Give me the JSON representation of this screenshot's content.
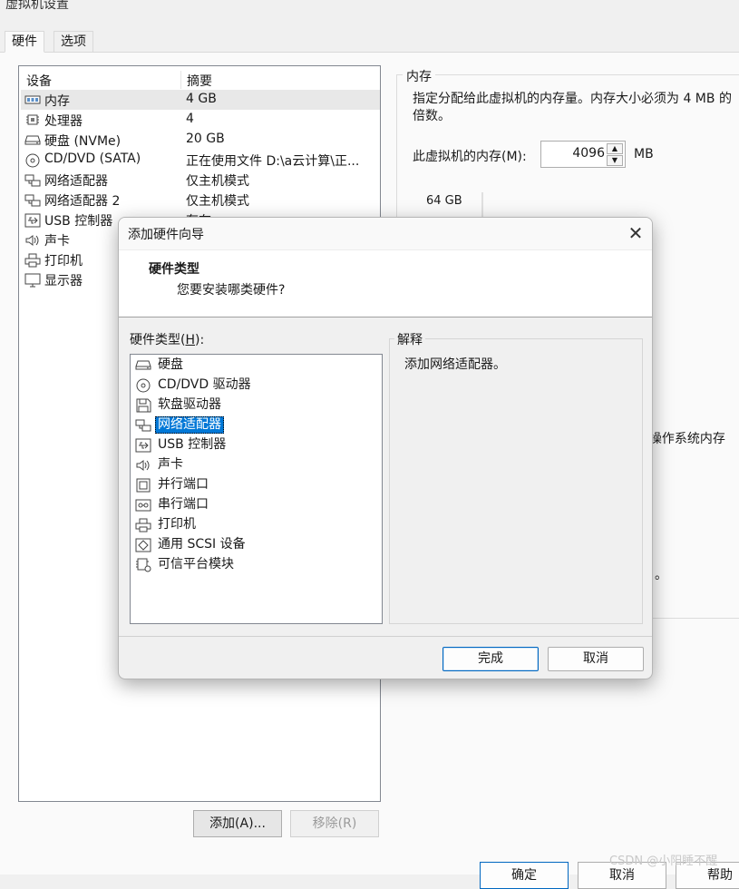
{
  "window": {
    "title": "虚拟机设置"
  },
  "tabs": [
    {
      "label": "硬件"
    },
    {
      "label": "选项"
    }
  ],
  "device_table": {
    "headers": [
      "设备",
      "摘要"
    ],
    "rows": [
      {
        "name": "内存",
        "summary": "4 GB",
        "icon": "memory-icon",
        "selected": true
      },
      {
        "name": "处理器",
        "summary": "4",
        "icon": "cpu-icon"
      },
      {
        "name": "硬盘 (NVMe)",
        "summary": "20 GB",
        "icon": "hard-disk-icon"
      },
      {
        "name": "CD/DVD (SATA)",
        "summary": "正在使用文件 D:\\a云计算\\正...",
        "icon": "cd-dvd-icon"
      },
      {
        "name": "网络适配器",
        "summary": "仅主机模式",
        "icon": "network-adapter-icon"
      },
      {
        "name": "网络适配器 2",
        "summary": "仅主机模式",
        "icon": "network-adapter-icon"
      },
      {
        "name": "USB 控制器",
        "summary": "存在",
        "icon": "usb-icon"
      },
      {
        "name": "声卡",
        "summary": "",
        "icon": "speaker-icon"
      },
      {
        "name": "打印机",
        "summary": "",
        "icon": "printer-icon"
      },
      {
        "name": "显示器",
        "summary": "",
        "icon": "monitor-icon"
      }
    ]
  },
  "device_buttons": {
    "add": "添加(A)...",
    "remove": "移除(R)"
  },
  "memory_panel": {
    "group_title": "内存",
    "description": "指定分配给此虚拟机的内存量。内存大小必须为 4 MB 的倍数。",
    "memory_label": "此虚拟机的内存(M):",
    "memory_value": "4096",
    "unit": "MB",
    "slider_top_label": "64 GB",
    "bg_text_1": "l操作系统内存",
    "bg_text_2": "。"
  },
  "footer_buttons": {
    "ok": "确定",
    "cancel": "取消",
    "help": "帮助"
  },
  "watermark": "CSDN @小阳睡不醒",
  "dialog": {
    "title": "添加硬件向导",
    "close_glyph": "✕",
    "header_title": "硬件类型",
    "header_subtitle": "您要安装哪类硬件?",
    "list_label": "硬件类型(H):",
    "list_label_text": "硬件类型(",
    "list_label_key": "H",
    "list_label_tail": "):",
    "explanation_title": "解释",
    "explanation_text": "添加网络适配器。",
    "items": [
      {
        "label": "硬盘",
        "icon": "hard-disk-icon"
      },
      {
        "label": "CD/DVD 驱动器",
        "icon": "cd-dvd-icon"
      },
      {
        "label": "软盘驱动器",
        "icon": "floppy-icon"
      },
      {
        "label": "网络适配器",
        "icon": "network-adapter-icon",
        "selected": true
      },
      {
        "label": "USB 控制器",
        "icon": "usb-icon"
      },
      {
        "label": "声卡",
        "icon": "speaker-icon"
      },
      {
        "label": "并行端口",
        "icon": "parallel-port-icon"
      },
      {
        "label": "串行端口",
        "icon": "serial-port-icon"
      },
      {
        "label": "打印机",
        "icon": "printer-icon"
      },
      {
        "label": "通用 SCSI 设备",
        "icon": "scsi-icon"
      },
      {
        "label": "可信平台模块",
        "icon": "tpm-icon"
      }
    ],
    "finish_label": "完成",
    "cancel_label": "取消"
  }
}
